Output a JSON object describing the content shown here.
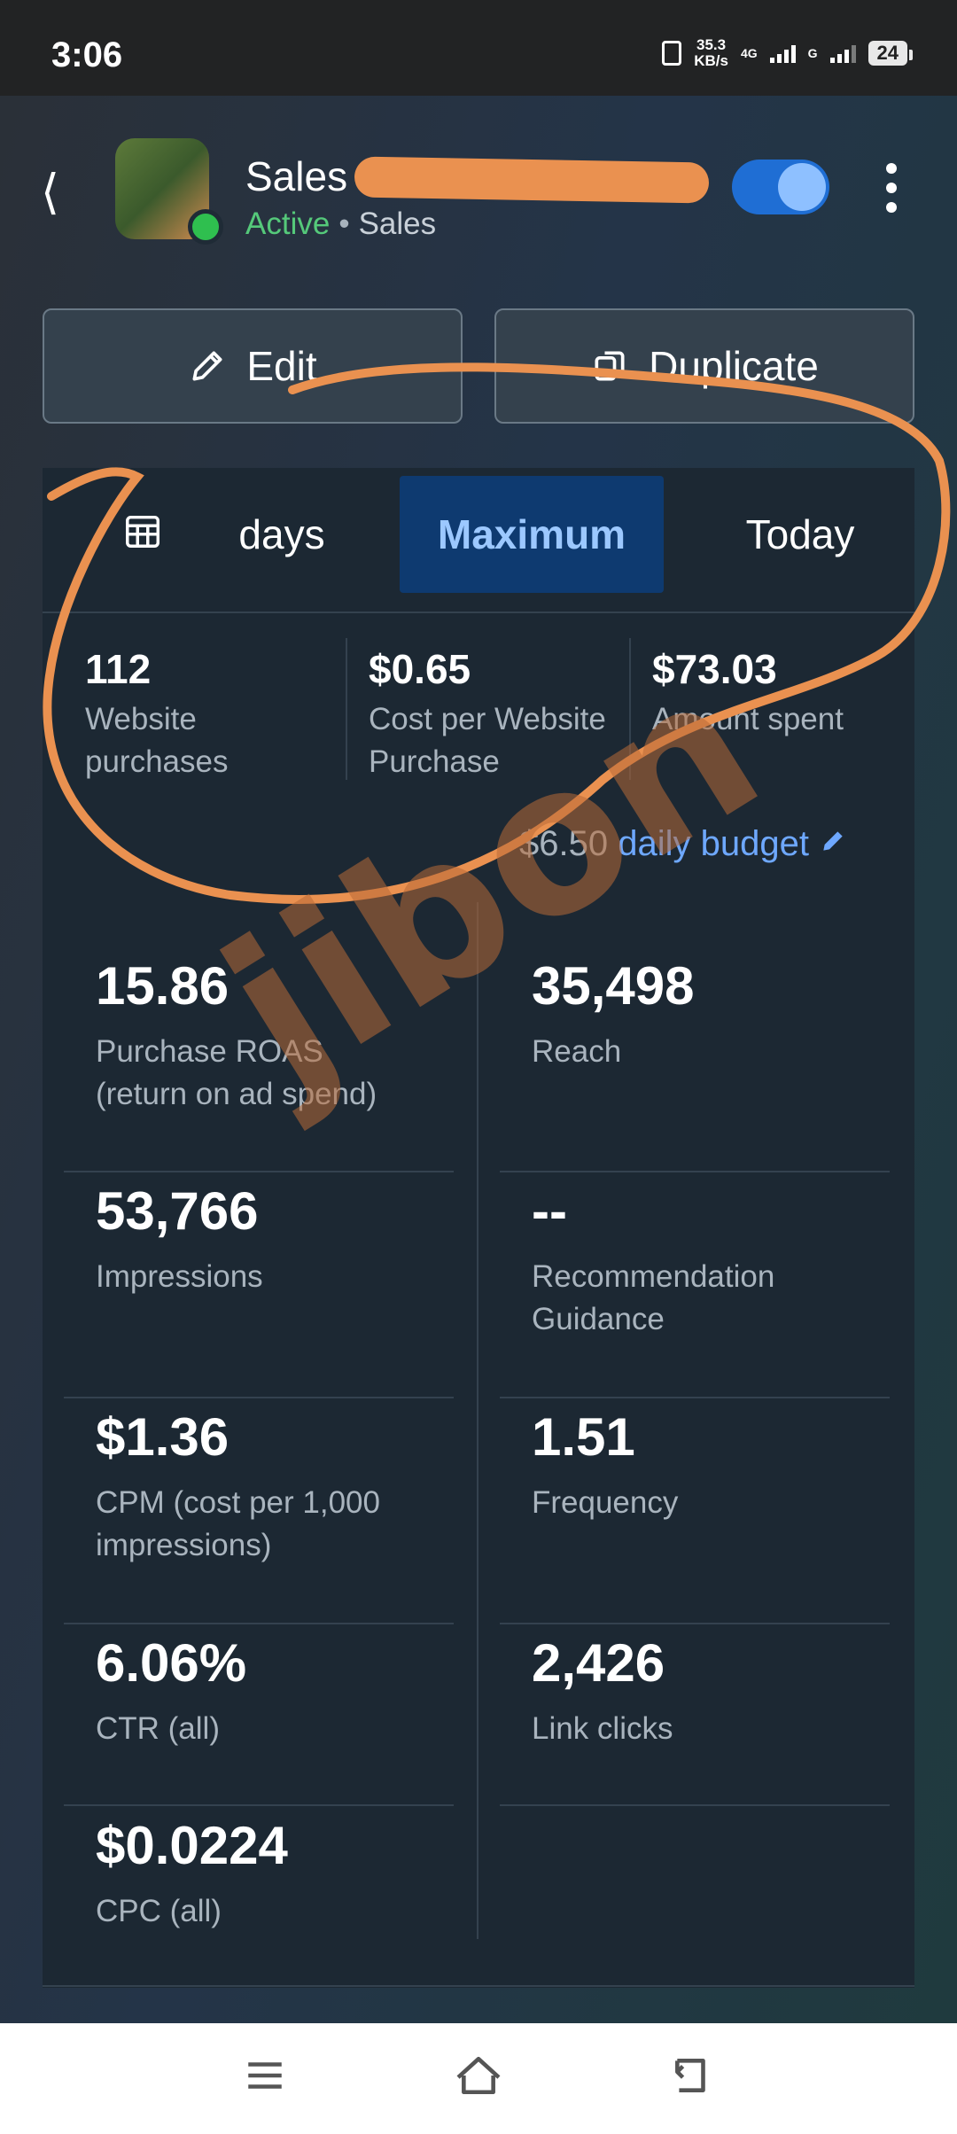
{
  "status_bar": {
    "time": "3:06",
    "speed_value": "35.3",
    "speed_unit": "KB/s",
    "net1": "4G",
    "net2": "G",
    "battery": "24"
  },
  "header": {
    "title": "Sales P",
    "status": "Active",
    "separator": "•",
    "type": "Sales",
    "toggle_on": true
  },
  "actions": {
    "edit_label": "Edit",
    "duplicate_label": "Duplicate"
  },
  "date_tabs": {
    "days_label": "days",
    "maximum_label": "Maximum",
    "today_label": "Today",
    "selected": "Maximum"
  },
  "summary": [
    {
      "value": "112",
      "label": "Website purchases"
    },
    {
      "value": "$0.65",
      "label": "Cost per Website Purchase"
    },
    {
      "value": "$73.03",
      "label": "Amount spent"
    }
  ],
  "budget": {
    "amount": "$6.50",
    "label": "daily budget"
  },
  "metrics": [
    {
      "value": "15.86",
      "label": "Purchase ROAS (return on ad spend)"
    },
    {
      "value": "35,498",
      "label": "Reach"
    },
    {
      "value": "53,766",
      "label": "Impressions"
    },
    {
      "value": "--",
      "label": "Recommendation Guidance"
    },
    {
      "value": "$1.36",
      "label": "CPM (cost per 1,000 impressions)"
    },
    {
      "value": "1.51",
      "label": "Frequency"
    },
    {
      "value": "6.06%",
      "label": "CTR (all)"
    },
    {
      "value": "2,426",
      "label": "Link clicks"
    },
    {
      "value": "$0.0224",
      "label": "CPC (all)"
    }
  ],
  "watermark": "jibon",
  "colors": {
    "accent": "#1f6ed4",
    "active_green": "#55c97a",
    "annotation_orange": "#ea9150",
    "selected_tab_bg": "#0e3a70"
  }
}
